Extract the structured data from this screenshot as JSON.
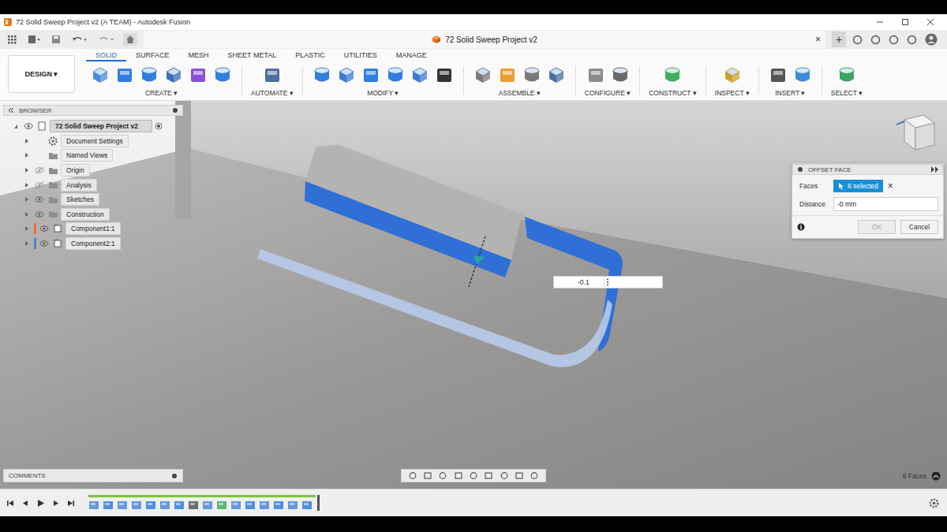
{
  "window": {
    "title": "72 Solid Sweep Project v2 (A TEAM) - Autodesk Fusion"
  },
  "document_tab": {
    "title": "72 Solid Sweep Project v2",
    "close": "×",
    "new_tab": "+"
  },
  "workspace": {
    "label": "DESIGN ▾"
  },
  "tabs": [
    {
      "label": "SOLID",
      "selected": true
    },
    {
      "label": "SURFACE",
      "selected": false
    },
    {
      "label": "MESH",
      "selected": false
    },
    {
      "label": "SHEET METAL",
      "selected": false
    },
    {
      "label": "PLASTIC",
      "selected": false
    },
    {
      "label": "UTILITIES",
      "selected": false
    },
    {
      "label": "MANAGE",
      "selected": false
    }
  ],
  "tool_groups": [
    {
      "label": "CREATE ▾"
    },
    {
      "label": "AUTOMATE ▾"
    },
    {
      "label": "MODIFY ▾"
    },
    {
      "label": "ASSEMBLE ▾"
    },
    {
      "label": "CONFIGURE ▾"
    },
    {
      "label": "CONSTRUCT ▾"
    },
    {
      "label": "INSPECT ▾"
    },
    {
      "label": "INSERT ▾"
    },
    {
      "label": "SELECT ▾"
    }
  ],
  "browser": {
    "title": "BROWSER",
    "items": [
      {
        "label": "72 Solid Sweep Project v2",
        "kind": "root",
        "visible": true,
        "expanded": true,
        "selected": true
      },
      {
        "label": "Document Settings",
        "kind": "settings",
        "visible": true,
        "expanded": false,
        "selected": false
      },
      {
        "label": "Named Views",
        "kind": "views",
        "visible": true,
        "expanded": false,
        "selected": false
      },
      {
        "label": "Origin",
        "kind": "folder",
        "visible": false,
        "expanded": false,
        "selected": false
      },
      {
        "label": "Analysis",
        "kind": "folder",
        "visible": false,
        "expanded": false,
        "selected": false
      },
      {
        "label": "Sketches",
        "kind": "folder",
        "visible": true,
        "expanded": false,
        "selected": false
      },
      {
        "label": "Construction",
        "kind": "folder",
        "visible": true,
        "expanded": false,
        "selected": false
      },
      {
        "label": "Component1:1",
        "kind": "component",
        "visible": true,
        "expanded": false,
        "selected": false,
        "color": "#e0742c"
      },
      {
        "label": "Component2:1",
        "kind": "component",
        "visible": true,
        "expanded": false,
        "selected": false,
        "color": "#4a7fd0"
      }
    ]
  },
  "offset_face": {
    "title": "OFFSET FACE",
    "clear": "×",
    "fields": [
      {
        "label": "Faces",
        "value": "6 selected",
        "kind": "selection"
      },
      {
        "label": "Distance",
        "value": "-0 mm",
        "kind": "input"
      }
    ],
    "buttons": [
      {
        "label": "OK",
        "disabled": true
      },
      {
        "label": "Cancel",
        "disabled": false
      }
    ]
  },
  "distance_input": {
    "value": "-0.1"
  },
  "comments": {
    "title": "COMMENTS"
  },
  "status": {
    "selection": "6 Faces"
  },
  "timeline": {
    "level": 1
  }
}
